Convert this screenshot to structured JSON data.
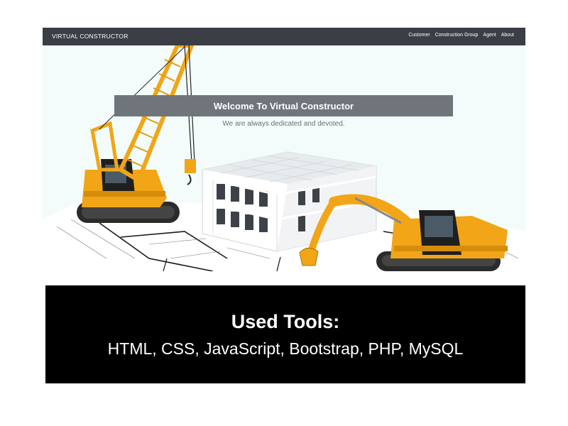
{
  "navbar": {
    "brand": "VIRTUAL CONSTRUCTOR",
    "links": [
      "Customer",
      "Construction Group",
      "Agent",
      "About"
    ]
  },
  "hero": {
    "title": "Welcome To Virtual Constructor",
    "tagline": "We are always dedicated and devoted."
  },
  "tools": {
    "heading": "Used Tools:",
    "list": "HTML, CSS, JavaScript, Bootstrap, PHP, MySQL"
  },
  "colors": {
    "navbar_bg": "#3b3f45",
    "hero_bg": "#f3fcfb",
    "welcome_box": "#70757c",
    "machine_yellow": "#f2a516",
    "panel_bg": "#000000"
  },
  "icons": [
    "crane-illustration",
    "building-illustration",
    "excavator-illustration",
    "blueprint-illustration"
  ]
}
